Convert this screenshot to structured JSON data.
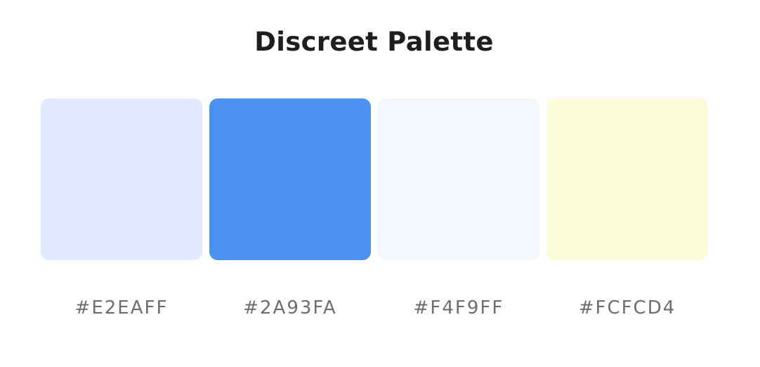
{
  "title": "Discreet Palette",
  "swatches": [
    {
      "color": "#E2EAFF",
      "label": "#E2EAFF",
      "name": "swatch-e2eaff"
    },
    {
      "color": "#4A91F1",
      "label": "#2A93FA",
      "name": "swatch-2a93fa"
    },
    {
      "color": "#F4F7FD",
      "label": "#F4F9FF",
      "name": "swatch-f4f9ff"
    },
    {
      "color": "#FCFCD8",
      "label": "#FCFCD4",
      "name": "swatch-fcfcd4"
    }
  ]
}
